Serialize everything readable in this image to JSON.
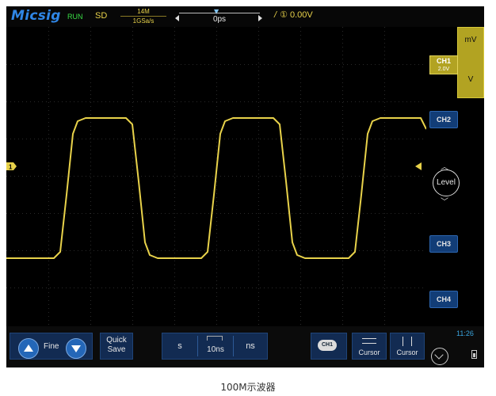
{
  "topbar": {
    "brand": "Micsig",
    "run_state": "RUN",
    "mode": "SD",
    "memory_depth": "14M",
    "sample_rate": "1GSa/s",
    "horizontal_delay": "0ps",
    "trigger_slope": "/",
    "trigger_source": "①",
    "trigger_level": "0.00V"
  },
  "right_panel": {
    "unit_options": [
      "mV",
      "V"
    ],
    "ch1": {
      "label": "CH1",
      "scale": "2.0V"
    },
    "ch2": "CH2",
    "ch3": "CH3",
    "ch4": "CH4",
    "level_label": "Level"
  },
  "trace": {
    "channel_marker": "1",
    "color": "#e8d24a"
  },
  "bottom_bar": {
    "fine_label": "Fine",
    "quick_save": "Quick\nSave",
    "unit_s": "s",
    "timebase": "10ns",
    "unit_ns": "ns",
    "ch_icon_label": "CH1",
    "cursor_h_label": "Cursor",
    "cursor_v_label": "Cursor",
    "clock": "11:26"
  },
  "caption": "100M示波器",
  "colors": {
    "background": "#000000",
    "accent_blue": "#2f86e6",
    "trace_yellow": "#e8d24a"
  }
}
